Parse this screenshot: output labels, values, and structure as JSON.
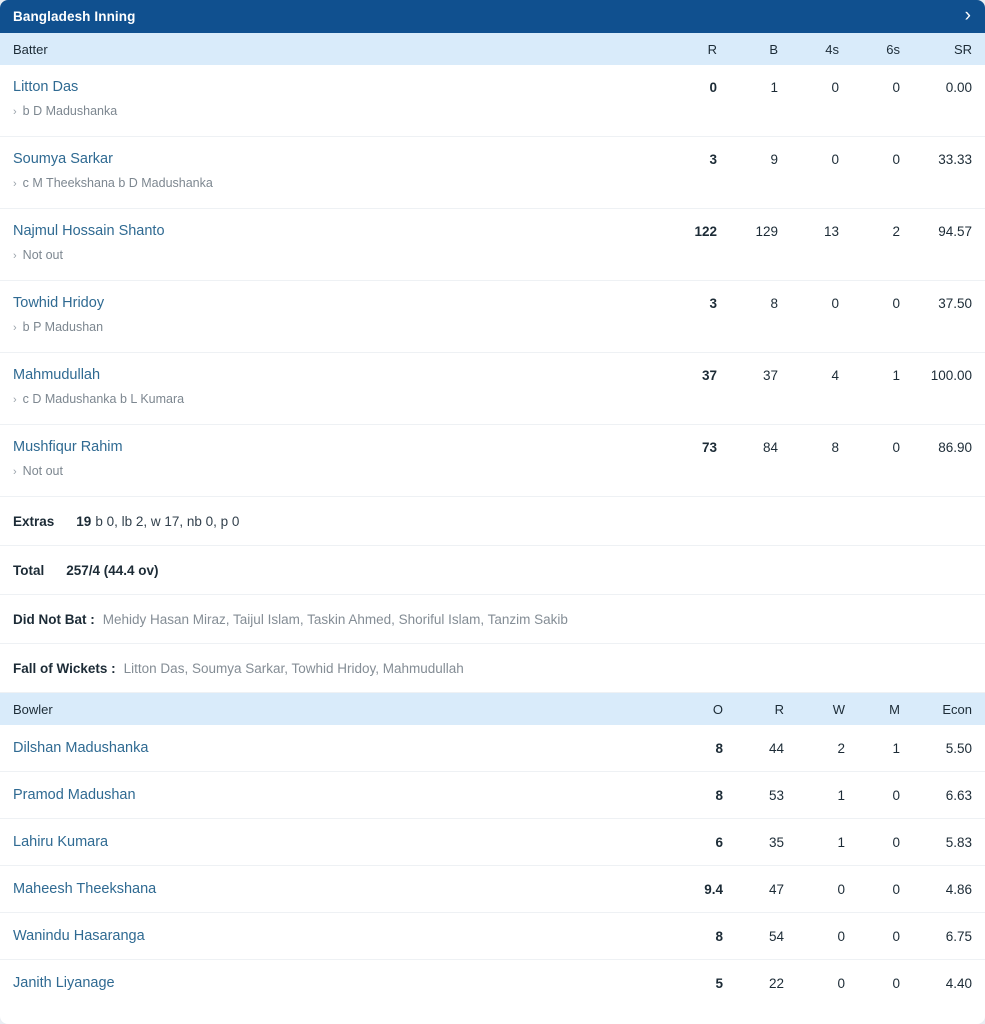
{
  "header": {
    "title": "Bangladesh Inning",
    "expand_icon": "chevron-right-icon",
    "accent_color": "#10508f"
  },
  "batting": {
    "columns": {
      "name": "Batter",
      "runs": "R",
      "balls": "B",
      "fours": "4s",
      "sixes": "6s",
      "strike_rate": "SR"
    },
    "header_bg": "#d9ebfa",
    "rows": [
      {
        "name": "Litton Das",
        "dismissal": "b D Madushanka",
        "R": "0",
        "B": "1",
        "4s": "0",
        "6s": "0",
        "SR": "0.00"
      },
      {
        "name": "Soumya Sarkar",
        "dismissal": "c M Theekshana b D Madushanka",
        "R": "3",
        "B": "9",
        "4s": "0",
        "6s": "0",
        "SR": "33.33"
      },
      {
        "name": "Najmul Hossain Shanto",
        "dismissal": "Not out",
        "R": "122",
        "B": "129",
        "4s": "13",
        "6s": "2",
        "SR": "94.57"
      },
      {
        "name": "Towhid Hridoy",
        "dismissal": "b P Madushan",
        "R": "3",
        "B": "8",
        "4s": "0",
        "6s": "0",
        "SR": "37.50"
      },
      {
        "name": "Mahmudullah",
        "dismissal": "c D Madushanka b L Kumara",
        "R": "37",
        "B": "37",
        "4s": "4",
        "6s": "1",
        "SR": "100.00"
      },
      {
        "name": "Mushfiqur Rahim",
        "dismissal": "Not out",
        "R": "73",
        "B": "84",
        "4s": "8",
        "6s": "0",
        "SR": "86.90"
      }
    ]
  },
  "summary": {
    "extras_label": "Extras",
    "extras_total": "19",
    "extras_detail": "b 0, lb 2, w 17, nb 0, p 0",
    "total_label": "Total",
    "total_value": "257/4 (44.4 ov)",
    "did_not_bat_label": "Did Not Bat :",
    "did_not_bat_value": "Mehidy Hasan Miraz, Taijul Islam, Taskin Ahmed, Shoriful Islam, Tanzim Sakib",
    "fall_of_wickets_label": "Fall of Wickets :",
    "fall_of_wickets_value": "Litton Das, Soumya Sarkar, Towhid Hridoy, Mahmudullah"
  },
  "bowling": {
    "columns": {
      "name": "Bowler",
      "overs": "O",
      "runs": "R",
      "wickets": "W",
      "maidens": "M",
      "economy": "Econ"
    },
    "rows": [
      {
        "name": "Dilshan Madushanka",
        "O": "8",
        "R": "44",
        "W": "2",
        "M": "1",
        "Econ": "5.50"
      },
      {
        "name": "Pramod Madushan",
        "O": "8",
        "R": "53",
        "W": "1",
        "M": "0",
        "Econ": "6.63"
      },
      {
        "name": "Lahiru Kumara",
        "O": "6",
        "R": "35",
        "W": "1",
        "M": "0",
        "Econ": "5.83"
      },
      {
        "name": "Maheesh Theekshana",
        "O": "9.4",
        "R": "47",
        "W": "0",
        "M": "0",
        "Econ": "4.86"
      },
      {
        "name": "Wanindu Hasaranga",
        "O": "8",
        "R": "54",
        "W": "0",
        "M": "0",
        "Econ": "6.75"
      },
      {
        "name": "Janith Liyanage",
        "O": "5",
        "R": "22",
        "W": "0",
        "M": "0",
        "Econ": "4.40"
      }
    ]
  }
}
